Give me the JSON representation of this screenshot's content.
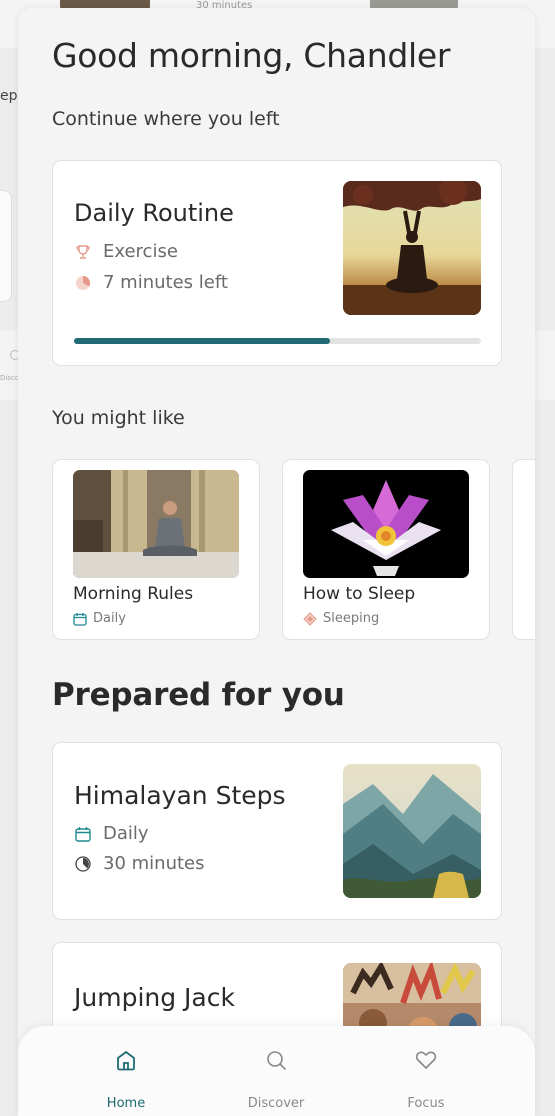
{
  "background": {
    "peek_duration": "30 minutes",
    "peek_text_left": "ep",
    "peek_tab_label": "Disco"
  },
  "greeting": "Good morning, Chandler",
  "continue_section": {
    "heading": "Continue where you left",
    "card": {
      "title": "Daily Routine",
      "category": "Exercise",
      "time_left": "7 minutes left",
      "progress": 0.63,
      "category_icon": "trophy-icon",
      "time_icon": "timer-icon"
    }
  },
  "like_section": {
    "heading": "You might like",
    "items": [
      {
        "title": "Morning Rules",
        "tag": "Daily",
        "icon": "calendar-icon"
      },
      {
        "title": "How to Sleep",
        "tag": "Sleeping",
        "icon": "diamond-icon"
      }
    ]
  },
  "prepared_section": {
    "heading": "Prepared for you",
    "items": [
      {
        "title": "Himalayan Steps",
        "tag": "Daily",
        "duration": "30 minutes"
      },
      {
        "title": "Jumping Jack"
      }
    ]
  },
  "tabbar": {
    "tabs": [
      {
        "label": "Home",
        "icon": "home-icon",
        "active": true
      },
      {
        "label": "Discover",
        "icon": "search-icon",
        "active": false
      },
      {
        "label": "Focus",
        "icon": "heart-icon",
        "active": false
      }
    ]
  },
  "colors": {
    "accent": "#1f6a73",
    "muted_icon": "#e59a8a"
  }
}
